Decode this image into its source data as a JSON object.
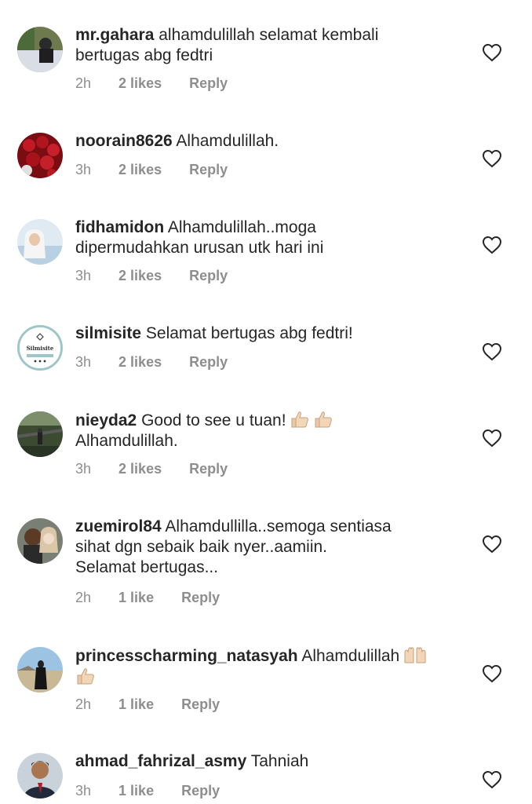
{
  "comments": [
    {
      "username": "mr.gahara",
      "text": "alhamdulillah selamat kembali",
      "text2": "bertugas abg fedtri",
      "time": "2h",
      "likes": "2 likes",
      "reply": "Reply"
    },
    {
      "username": "noorain8626",
      "text": "Alhamdulillah.",
      "time": "3h",
      "likes": "2 likes",
      "reply": "Reply"
    },
    {
      "username": "fidhamidon",
      "text": "Alhamdulillah..moga",
      "text2": "dipermudahkan urusan utk hari ini",
      "time": "3h",
      "likes": "2 likes",
      "reply": "Reply"
    },
    {
      "username": "silmisite",
      "text": "Selamat bertugas abg fedtri!",
      "time": "3h",
      "likes": "2 likes",
      "reply": "Reply",
      "avatar_text": "Silmisite"
    },
    {
      "username": "nieyda2",
      "text": "Good to see u tuan!",
      "text2": "Alhamdulillah.",
      "time": "3h",
      "likes": "2 likes",
      "reply": "Reply"
    },
    {
      "username": "zuemirol84",
      "text": "Alhamdullilla..semoga sentiasa",
      "text2": "sihat dgn sebaik baik nyer..aamiin.",
      "text3": "Selamat bertugas...",
      "time": "2h",
      "likes": "1 like",
      "reply": "Reply"
    },
    {
      "username": "princesscharming_natasyah",
      "text": "Alhamdulillah",
      "time": "2h",
      "likes": "1 like",
      "reply": "Reply"
    },
    {
      "username": "ahmad_fahrizal_asmy",
      "text": "Tahniah",
      "time": "3h",
      "likes": "1 like",
      "reply": "Reply"
    }
  ],
  "icons": {
    "like": "heart-outline-icon",
    "thumbs_up": "thumbs-up-emoji",
    "raised_hands": "raised-hands-emoji"
  },
  "colors": {
    "text": "#262626",
    "meta": "#8e8e8e"
  }
}
